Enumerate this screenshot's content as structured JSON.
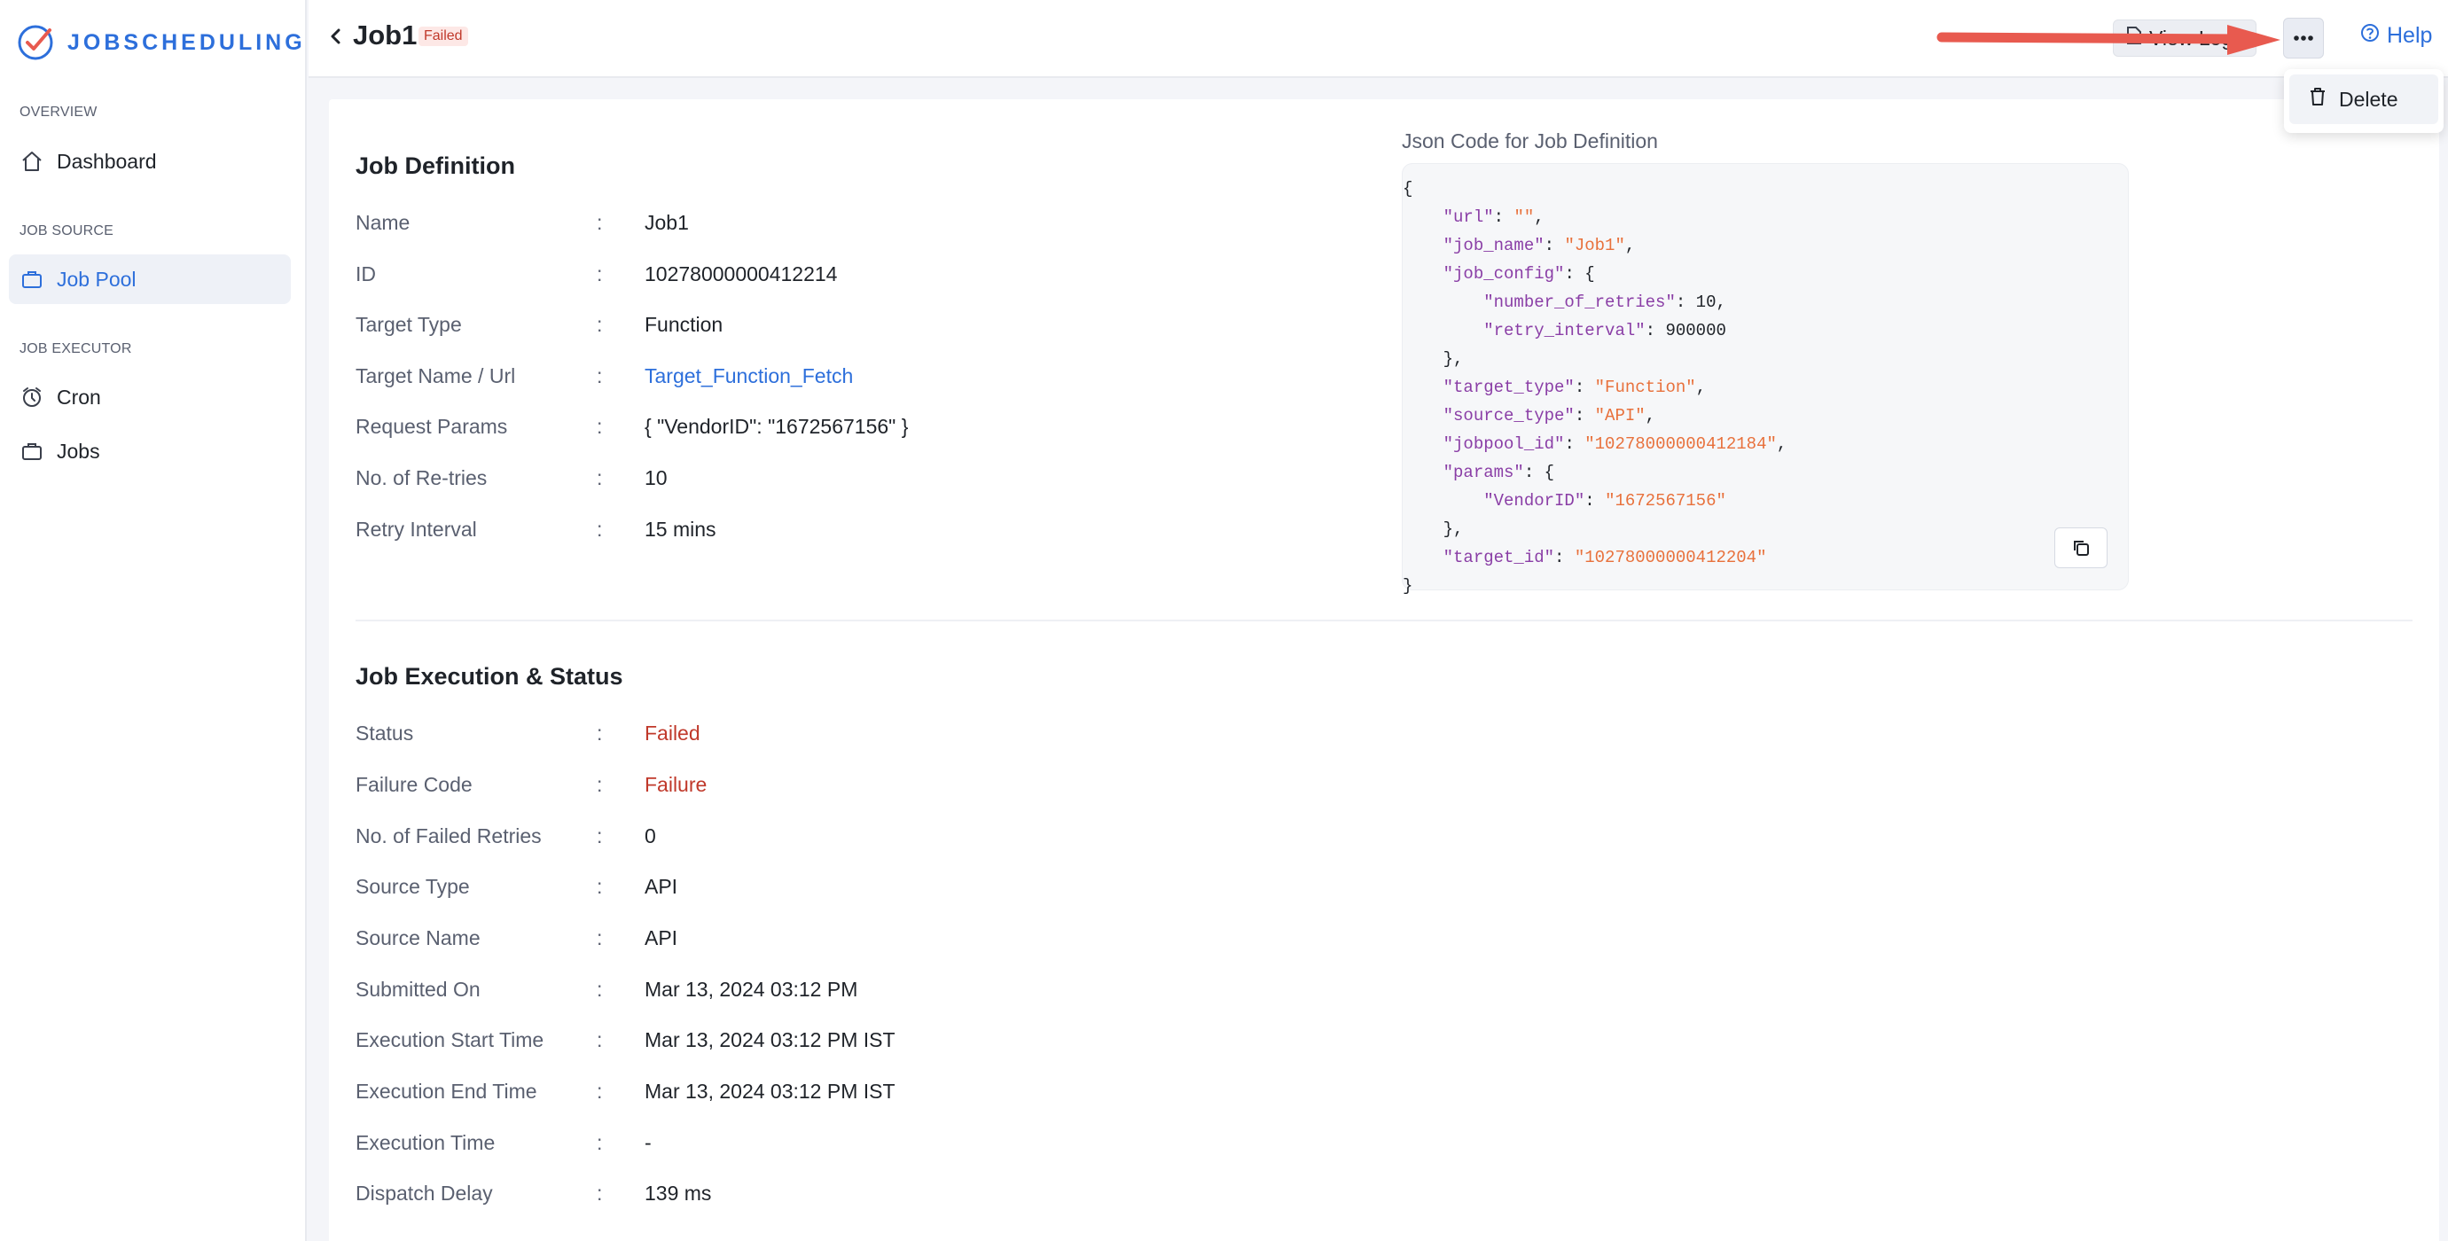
{
  "brand": {
    "name": "JOBSCHEDULING"
  },
  "sidebar": {
    "sections": [
      {
        "label": "OVERVIEW",
        "items": [
          {
            "label": "Dashboard",
            "icon": "home-icon"
          }
        ]
      },
      {
        "label": "JOB SOURCE",
        "items": [
          {
            "label": "Job Pool",
            "icon": "briefcase-icon",
            "active": true
          }
        ]
      },
      {
        "label": "JOB EXECUTOR",
        "items": [
          {
            "label": "Cron",
            "icon": "alarm-clock-icon"
          },
          {
            "label": "Jobs",
            "icon": "briefcase-icon"
          }
        ]
      }
    ]
  },
  "header": {
    "title": "Job1",
    "status_badge": "Failed",
    "view_logs_label": "View Logs",
    "help_label": "Help"
  },
  "dropdown": {
    "items": [
      {
        "label": "Delete",
        "icon": "trash-icon"
      }
    ]
  },
  "job_definition": {
    "title": "Job Definition",
    "fields": [
      {
        "label": "Name",
        "value": "Job1"
      },
      {
        "label": "ID",
        "value": "10278000000412214"
      },
      {
        "label": "Target Type",
        "value": "Function"
      },
      {
        "label": "Target Name / Url",
        "value": "Target_Function_Fetch"
      },
      {
        "label": "Request Params",
        "value": "{ \"VendorID\": \"1672567156\" }"
      },
      {
        "label": "No. of Re-tries",
        "value": "10"
      },
      {
        "label": "Retry Interval",
        "value": "15 mins"
      }
    ]
  },
  "json_panel": {
    "label": "Json Code for Job Definition",
    "lines": [
      "{",
      "    \"url\": \"\",",
      "    \"job_name\": \"Job1\",",
      "    \"job_config\": {",
      "        \"number_of_retries\": 10,",
      "        \"retry_interval\": 900000",
      "    },",
      "    \"target_type\": \"Function\",",
      "    \"source_type\": \"API\",",
      "    \"jobpool_id\": \"10278000000412184\",",
      "    \"params\": {",
      "        \"VendorID\": \"1672567156\"",
      "    },",
      "    \"target_id\": \"10278000000412204\"",
      "}"
    ]
  },
  "job_execution": {
    "title": "Job Execution & Status",
    "fields": [
      {
        "label": "Status",
        "value": "Failed"
      },
      {
        "label": "Failure Code",
        "value": "Failure"
      },
      {
        "label": "No. of Failed Retries",
        "value": "0"
      },
      {
        "label": "Source Type",
        "value": "API"
      },
      {
        "label": "Source Name",
        "value": "API"
      },
      {
        "label": "Submitted On",
        "value": "Mar 13, 2024 03:12 PM"
      },
      {
        "label": "Execution Start Time",
        "value": "Mar 13, 2024 03:12 PM IST"
      },
      {
        "label": "Execution End Time",
        "value": "Mar 13, 2024 03:12 PM IST"
      },
      {
        "label": "Execution Time",
        "value": "-"
      },
      {
        "label": "Dispatch Delay",
        "value": "139 ms"
      }
    ]
  },
  "colors": {
    "accent": "#2d6fdb",
    "failed": "#c0392b",
    "json_key": "#8a3ea6",
    "json_string": "#e8713c",
    "annotation_arrow": "#e85a4f"
  }
}
